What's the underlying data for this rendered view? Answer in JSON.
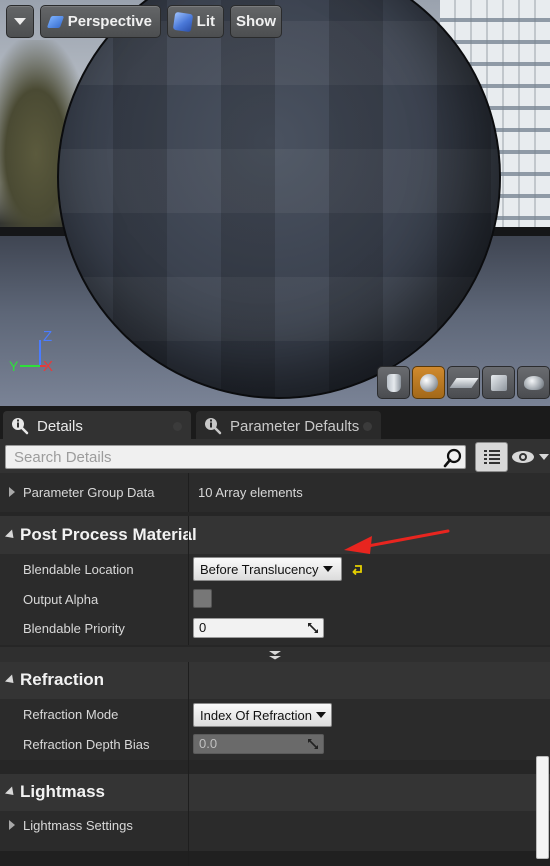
{
  "viewport": {
    "perspective_label": "Perspective",
    "lit_label": "Lit",
    "show_label": "Show",
    "axis": {
      "z": "Z",
      "x": "X"
    }
  },
  "tabs": [
    {
      "label": "Details"
    },
    {
      "label": "Parameter Defaults"
    }
  ],
  "search": {
    "placeholder": "Search Details"
  },
  "properties": {
    "parameter_group_data": {
      "label": "Parameter Group Data",
      "value": "10 Array elements"
    },
    "post_process": {
      "title": "Post Process Material",
      "blendable_location": {
        "label": "Blendable Location",
        "value": "Before Translucency"
      },
      "output_alpha": {
        "label": "Output Alpha",
        "checked": false
      },
      "blendable_priority": {
        "label": "Blendable Priority",
        "value": "0"
      }
    },
    "refraction": {
      "title": "Refraction",
      "mode": {
        "label": "Refraction Mode",
        "value": "Index Of Refraction"
      },
      "depth_bias": {
        "label": "Refraction Depth Bias",
        "value": "0.0"
      }
    },
    "lightmass": {
      "title": "Lightmass",
      "settings": {
        "label": "Lightmass Settings"
      }
    }
  },
  "colors": {
    "annotation_arrow": "#e8251f",
    "active_tool": "#d08a2e",
    "reset_arrow": "#e6d000"
  }
}
